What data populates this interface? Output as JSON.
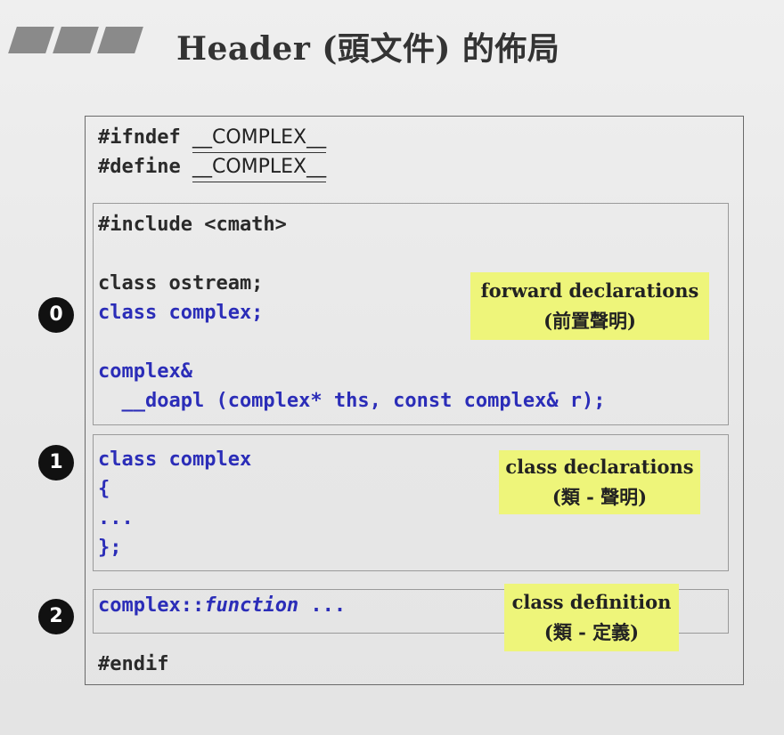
{
  "slide": {
    "title": "Header (頭文件) 的佈局"
  },
  "guard": {
    "ifndef_keyword": "#ifndef",
    "define_keyword": "#define",
    "macro_name": "COMPLEX"
  },
  "section0": {
    "bullet": "0",
    "include_line": "#include <cmath>",
    "line1": "class ostream;",
    "line2": "class complex;",
    "line3": "complex&",
    "line4": "  __doapl (complex* ths, const complex& r);",
    "label_line1": "forward declarations",
    "label_line2": "(前置聲明)"
  },
  "section1": {
    "bullet": "1",
    "line1": "class complex",
    "line2": "{",
    "line3": "...",
    "line4": "};",
    "label_line1": "class declarations",
    "label_line2": "(類 - 聲明)"
  },
  "section2": {
    "bullet": "2",
    "prefix": "complex::",
    "function_word": "function",
    "suffix": " ...",
    "label_line1": "class definition",
    "label_line2": "(類 - 定義)"
  },
  "footer": {
    "endif_line": "#endif"
  },
  "colors": {
    "code_blue": "#2b2db8",
    "label_yellow": "#eef57a",
    "bullet_black": "#111111"
  }
}
